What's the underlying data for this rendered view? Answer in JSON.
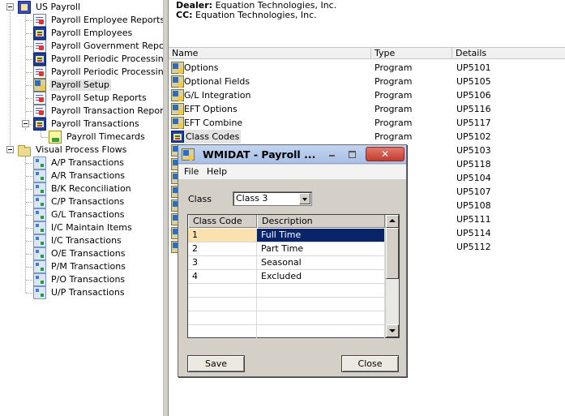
{
  "tree": {
    "root_label": "US Payroll",
    "items": [
      {
        "label": "Payroll Employee Reports",
        "icon": "report-icon"
      },
      {
        "label": "Payroll Employees",
        "icon": "program-icon"
      },
      {
        "label": "Payroll Government Reports",
        "icon": "report-icon"
      },
      {
        "label": "Payroll Periodic Processing",
        "icon": "program-icon"
      },
      {
        "label": "Payroll Periodic Processing Re",
        "icon": "report-icon"
      },
      {
        "label": "Payroll Setup",
        "icon": "setup-icon",
        "selected": true
      },
      {
        "label": "Payroll Setup Reports",
        "icon": "report-icon"
      },
      {
        "label": "Payroll Transaction Reports",
        "icon": "report-icon"
      },
      {
        "label": "Payroll Transactions",
        "icon": "program-icon"
      },
      {
        "label": "Payroll Timecards",
        "icon": "timecard-icon"
      }
    ],
    "vpf_label": "Visual Process Flows",
    "vpf_items": [
      "A/P Transactions",
      "A/R Transactions",
      "B/K Reconciliation",
      "C/P Transactions",
      "G/L Transactions",
      "I/C Maintain Items",
      "I/C Transactions",
      "O/E Transactions",
      "P/M Transactions",
      "P/O Transactions",
      "U/P Transactions"
    ]
  },
  "header": {
    "dealer_label": "Dealer:",
    "dealer_value": "Equation Technologies, Inc.",
    "cc_label": "CC:",
    "cc_value": "Equation Technologies, Inc."
  },
  "list": {
    "columns": [
      "Name",
      "Type",
      "Details"
    ],
    "rows": [
      {
        "name": "Options",
        "type": "Program",
        "details": "UP5101"
      },
      {
        "name": "Optional Fields",
        "type": "Program",
        "details": "UP5105"
      },
      {
        "name": "G/L Integration",
        "type": "Program",
        "details": "UP5106"
      },
      {
        "name": "EFT Options",
        "type": "Program",
        "details": "UP5116"
      },
      {
        "name": "EFT Combine",
        "type": "Program",
        "details": "UP5117"
      },
      {
        "name": "Class Codes",
        "type": "Program",
        "details": "UP5102",
        "selected": true
      },
      {
        "name": "",
        "type": "",
        "details": "UP5103"
      },
      {
        "name": "",
        "type": "",
        "details": "UP5118"
      },
      {
        "name": "",
        "type": "",
        "details": "UP5104"
      },
      {
        "name": "",
        "type": "",
        "details": "UP5107"
      },
      {
        "name": "",
        "type": "",
        "details": "UP5108"
      },
      {
        "name": "",
        "type": "",
        "details": "UP5111"
      },
      {
        "name": "",
        "type": "",
        "details": "UP5114"
      },
      {
        "name": "",
        "type": "",
        "details": "UP5112"
      }
    ]
  },
  "dialog": {
    "title": "WMIDAT - Payroll ...",
    "close_glyph": "✕",
    "menu": [
      "File",
      "Help"
    ],
    "class_label": "Class",
    "class_value": "Class 3",
    "grid_columns": [
      "Class Code",
      "Description"
    ],
    "grid_rows": [
      {
        "code": "1",
        "desc": "Full Time",
        "active": true
      },
      {
        "code": "2",
        "desc": "Part Time"
      },
      {
        "code": "3",
        "desc": "Seasonal"
      },
      {
        "code": "4",
        "desc": "Excluded"
      },
      {
        "code": "",
        "desc": ""
      },
      {
        "code": "",
        "desc": ""
      },
      {
        "code": "",
        "desc": ""
      },
      {
        "code": "",
        "desc": ""
      }
    ],
    "save_label": "Save",
    "close_label": "Close"
  }
}
